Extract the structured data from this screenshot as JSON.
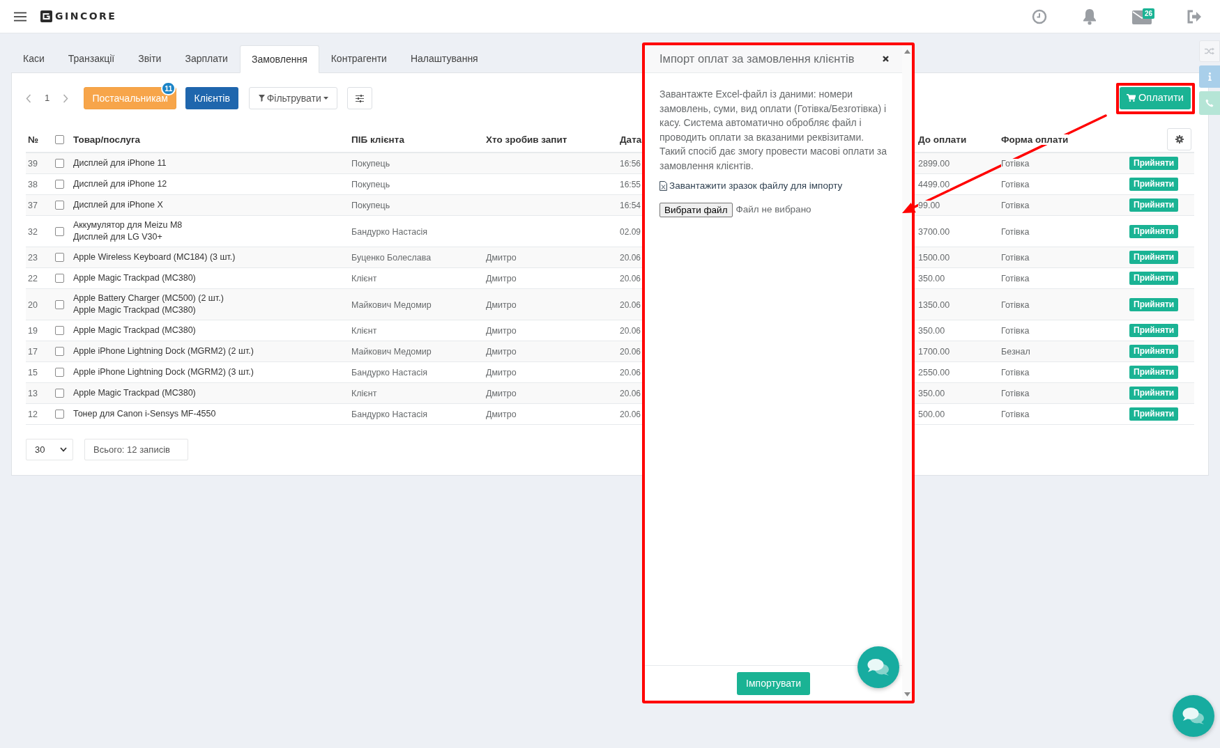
{
  "header": {
    "logo": "GINCORE",
    "mail_badge": "26"
  },
  "tabs": [
    {
      "label": "Каси",
      "selected": false
    },
    {
      "label": "Транзакції",
      "selected": false
    },
    {
      "label": "Звіти",
      "selected": false
    },
    {
      "label": "Зарплати",
      "selected": false
    },
    {
      "label": "Замовлення",
      "selected": true
    },
    {
      "label": "Контрагенти",
      "selected": false
    },
    {
      "label": "Налаштування",
      "selected": false
    }
  ],
  "toolbar": {
    "page": "1",
    "suppliers_button": {
      "label": "Постачальникам",
      "badge": "11"
    },
    "clients_button": {
      "label": "Клієнтів"
    },
    "filter_button": {
      "label": "Фільтрувати"
    },
    "pay_button": {
      "label": "Оплатити"
    }
  },
  "table": {
    "columns": [
      "№",
      "Товар/послуга",
      "ПІБ клієнта",
      "Хто зробив запит",
      "Дата",
      "До оплати",
      "Форма оплати"
    ],
    "select_all_checked": false,
    "rows": [
      {
        "number": "39",
        "checked": false,
        "products": [
          "Дисплей для iPhone 11"
        ],
        "client": "Покупець",
        "date": "16:56",
        "amount_due": "2899.00",
        "payment_method": "Готівка",
        "action": "Прийняти"
      },
      {
        "number": "38",
        "checked": false,
        "products": [
          "Дисплей для iPhone 12"
        ],
        "client": "Покупець",
        "date": "16:55",
        "amount_due": "4499.00",
        "payment_method": "Готівка",
        "action": "Прийняти"
      },
      {
        "number": "37",
        "checked": false,
        "products": [
          "Дисплей для iPhone X"
        ],
        "client": "Покупець",
        "date": "16:54",
        "amount_due": "99.00",
        "payment_method": "Готівка",
        "action": "Прийняти"
      },
      {
        "number": "32",
        "checked": false,
        "products": [
          "Аккумулятор для Meizu M8",
          "Дисплей для LG V30+"
        ],
        "client": "Бандурко Настасія",
        "date": "02.09",
        "amount_due": "3700.00",
        "payment_method": "Готівка",
        "action": "Прийняти"
      },
      {
        "number": "23",
        "checked": false,
        "products": [
          "Apple Wireless Keyboard (MC184) (3 шт.)"
        ],
        "client": "Буценко Болеслава",
        "requested_by": "Дмитро",
        "date": "20.06",
        "amount_due": "1500.00",
        "payment_method": "Готівка",
        "action": "Прийняти"
      },
      {
        "number": "22",
        "checked": false,
        "products": [
          "Apple Magic Trackpad (MC380)"
        ],
        "client": "Клієнт",
        "requested_by": "Дмитро",
        "date": "20.06",
        "amount_due": "350.00",
        "payment_method": "Готівка",
        "action": "Прийняти"
      },
      {
        "number": "20",
        "checked": false,
        "products": [
          "Apple Battery Charger (MC500) (2 шт.)",
          "Apple Magic Trackpad (MC380)"
        ],
        "client": "Майкович Медомир",
        "requested_by": "Дмитро",
        "date": "20.06",
        "amount_due": "1350.00",
        "payment_method": "Готівка",
        "action": "Прийняти"
      },
      {
        "number": "19",
        "checked": false,
        "products": [
          "Apple Magic Trackpad (MC380)"
        ],
        "client": "Клієнт",
        "requested_by": "Дмитро",
        "date": "20.06",
        "amount_due": "350.00",
        "payment_method": "Готівка",
        "action": "Прийняти"
      },
      {
        "number": "17",
        "checked": false,
        "products": [
          "Apple iPhone Lightning Dock (MGRM2) (2 шт.)"
        ],
        "client": "Майкович Медомир",
        "requested_by": "Дмитро",
        "date": "20.06",
        "amount_due": "1700.00",
        "payment_method": "Безнал",
        "action": "Прийняти"
      },
      {
        "number": "15",
        "checked": false,
        "products": [
          "Apple iPhone Lightning Dock (MGRM2) (3 шт.)"
        ],
        "client": "Бандурко Настасія",
        "requested_by": "Дмитро",
        "date": "20.06",
        "amount_due": "2550.00",
        "payment_method": "Готівка",
        "action": "Прийняти"
      },
      {
        "number": "13",
        "checked": false,
        "products": [
          "Apple Magic Trackpad (MC380)"
        ],
        "client": "Клієнт",
        "requested_by": "Дмитро",
        "date": "20.06",
        "amount_due": "350.00",
        "payment_method": "Готівка",
        "action": "Прийняти"
      },
      {
        "number": "12",
        "checked": false,
        "products": [
          "Тонер для Canon i-Sensys MF-4550"
        ],
        "client": "Бандурко Настасія",
        "requested_by": "Дмитро",
        "date": "20.06",
        "amount_due": "500.00",
        "payment_method": "Готівка",
        "action": "Прийняти"
      }
    ]
  },
  "footer": {
    "page_size": "30",
    "total": "Всього: 12 записів"
  },
  "modal": {
    "title": "Імпорт оплат за замовлення клієнтів",
    "description": "Завантажте Excel-файл із даними: номери замовлень, суми, вид оплати (Готівка/Безготівка) і касу. Система автоматично обробляє файл і проводить оплати за вказаними реквізитами. Такий спосіб дає змогу провести масові оплати за замовлення клієнтів.",
    "sample_link": "Завантажити зразок файлу для імпорту",
    "file_button": "Вибрати файл",
    "file_status": "Файл не вибрано",
    "import_button": "Імпортувати"
  }
}
